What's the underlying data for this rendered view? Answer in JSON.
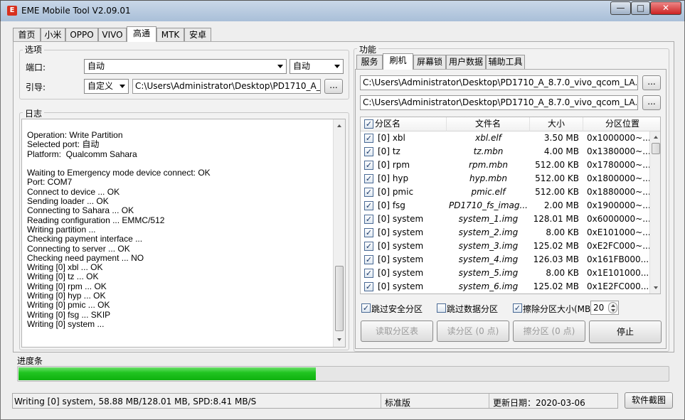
{
  "window": {
    "title": "EME Mobile Tool V2.09.01",
    "min": "—",
    "max": "□",
    "close": "✕"
  },
  "main_tabs": [
    "首页",
    "小米",
    "OPPO",
    "VIVO",
    "高通",
    "MTK",
    "安卓"
  ],
  "options": {
    "group_label": "选项",
    "port_label": "端口:",
    "port_value": "自动",
    "port_mode": "自动",
    "loader_label": "引导:",
    "loader_mode": "自定义",
    "loader_path": "C:\\Users\\Administrator\\Desktop\\PD1710_A_8.7.0",
    "browse": "..."
  },
  "log": {
    "group_label": "日志",
    "lines": "Operation: Write Partition\nSelected port: 自动\nPlatform:  Qualcomm Sahara\n\nWaiting to Emergency mode device connect: OK\nPort: COM7\nConnect to device ... OK\nSending loader ... OK\nConnecting to Sahara ... OK\nReading configuration ... EMMC/512\nWriting partition ...\nChecking payment interface ...\nConnecting to server ... OK\nChecking need payment ... NO\nWriting [0] xbl ... OK\nWriting [0] tz ... OK\nWriting [0] rpm ... OK\nWriting [0] hyp ... OK\nWriting [0] pmic ... OK\nWriting [0] fsg ... SKIP\nWriting [0] system ..."
  },
  "function": {
    "group_label": "功能",
    "tabs": [
      "服务",
      "刷机",
      "屏幕锁",
      "用户数据",
      "辅助工具"
    ],
    "path1": "C:\\Users\\Administrator\\Desktop\\PD1710_A_8.7.0_vivo_qcom_LA.UM.6.2.r",
    "path2": "C:\\Users\\Administrator\\Desktop\\PD1710_A_8.7.0_vivo_qcom_LA.UM.6.2.r",
    "browse": "...",
    "columns": [
      "分区名",
      "文件名",
      "大小",
      "分区位置"
    ],
    "rows": [
      {
        "name": "[0] xbl",
        "file": "xbl.elf",
        "size": "3.50 MB",
        "pos": "0x1000000~..."
      },
      {
        "name": "[0] tz",
        "file": "tz.mbn",
        "size": "4.00 MB",
        "pos": "0x1380000~..."
      },
      {
        "name": "[0] rpm",
        "file": "rpm.mbn",
        "size": "512.00 KB",
        "pos": "0x1780000~..."
      },
      {
        "name": "[0] hyp",
        "file": "hyp.mbn",
        "size": "512.00 KB",
        "pos": "0x1800000~..."
      },
      {
        "name": "[0] pmic",
        "file": "pmic.elf",
        "size": "512.00 KB",
        "pos": "0x1880000~..."
      },
      {
        "name": "[0] fsg",
        "file": "PD1710_fs_imag...",
        "size": "2.00 MB",
        "pos": "0x1900000~..."
      },
      {
        "name": "[0] system",
        "file": "system_1.img",
        "size": "128.01 MB",
        "pos": "0x6000000~..."
      },
      {
        "name": "[0] system",
        "file": "system_2.img",
        "size": "8.00 KB",
        "pos": "0xE101000~..."
      },
      {
        "name": "[0] system",
        "file": "system_3.img",
        "size": "125.02 MB",
        "pos": "0xE2FC000~..."
      },
      {
        "name": "[0] system",
        "file": "system_4.img",
        "size": "126.03 MB",
        "pos": "0x161FB000..."
      },
      {
        "name": "[0] system",
        "file": "system_5.img",
        "size": "8.00 KB",
        "pos": "0x1E101000..."
      },
      {
        "name": "[0] system",
        "file": "system_6.img",
        "size": "125.02 MB",
        "pos": "0x1E2FC000..."
      }
    ],
    "skip_security": "跳过安全分区",
    "skip_data": "跳过数据分区",
    "erase_size": "擦除分区大小(MB)",
    "erase_value": "20",
    "btn_read_table": "读取分区表",
    "btn_read_part": "读分区 (0 点)",
    "btn_erase_part": "擦分区 (0 点)",
    "btn_stop": "停止"
  },
  "progress": {
    "label": "进度条",
    "percent": 45.8
  },
  "status": {
    "text": "Writing [0] system, 58.88 MB/128.01 MB, SPD:8.41 MB/S",
    "edition": "标准版",
    "date": "更新日期：2020-03-06",
    "screenshot_btn": "软件截图"
  }
}
